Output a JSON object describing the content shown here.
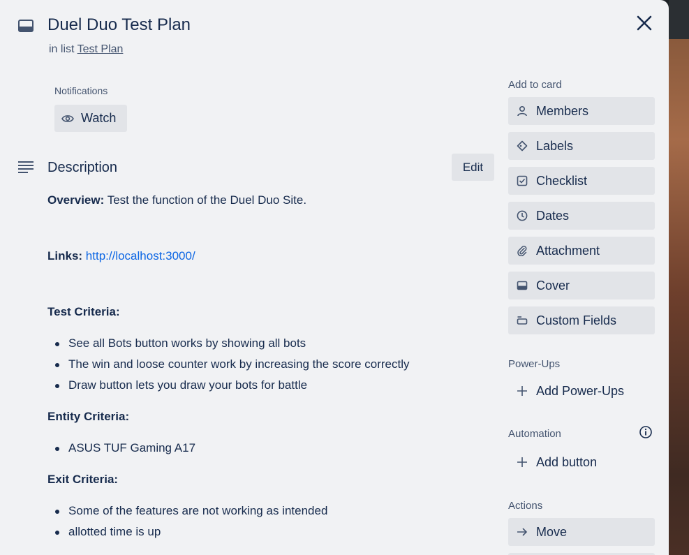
{
  "card": {
    "title": "Duel Duo Test Plan",
    "in_list_prefix": "in list",
    "list_name": "Test Plan"
  },
  "notifications": {
    "label": "Notifications",
    "watch_label": "Watch"
  },
  "description": {
    "heading": "Description",
    "edit_label": "Edit",
    "overview_label": "Overview:",
    "overview_text": "Test the function of the Duel Duo Site.",
    "links_label": "Links:",
    "links_url": "http://localhost:3000/",
    "test_criteria_label": "Test Criteria:",
    "test_criteria": [
      "See all Bots button works by showing all bots",
      "The win and loose counter work by increasing the score correctly",
      "Draw button lets you draw your bots for battle"
    ],
    "entity_criteria_label": "Entity Criteria:",
    "entity_criteria": [
      "ASUS TUF Gaming A17"
    ],
    "exit_criteria_label": "Exit Criteria:",
    "exit_criteria": [
      "Some of the features are not working as intended",
      "allotted time is up"
    ]
  },
  "sidebar": {
    "add_to_card_label": "Add to card",
    "add_to_card": [
      {
        "label": "Members",
        "icon": "person-icon"
      },
      {
        "label": "Labels",
        "icon": "tag-icon"
      },
      {
        "label": "Checklist",
        "icon": "checkbox-icon"
      },
      {
        "label": "Dates",
        "icon": "clock-icon"
      },
      {
        "label": "Attachment",
        "icon": "paperclip-icon"
      },
      {
        "label": "Cover",
        "icon": "cover-icon"
      },
      {
        "label": "Custom Fields",
        "icon": "custom-fields-icon"
      }
    ],
    "powerups_label": "Power-Ups",
    "add_powerups_label": "Add Power-Ups",
    "automation_label": "Automation",
    "add_button_label": "Add button",
    "actions_label": "Actions",
    "move_label": "Move"
  },
  "colors": {
    "modal_bg": "#f1f2f4",
    "button_bg": "#e2e4e8",
    "text": "#172b4d",
    "subtle_text": "#44546f",
    "link": "#0c66e4"
  }
}
